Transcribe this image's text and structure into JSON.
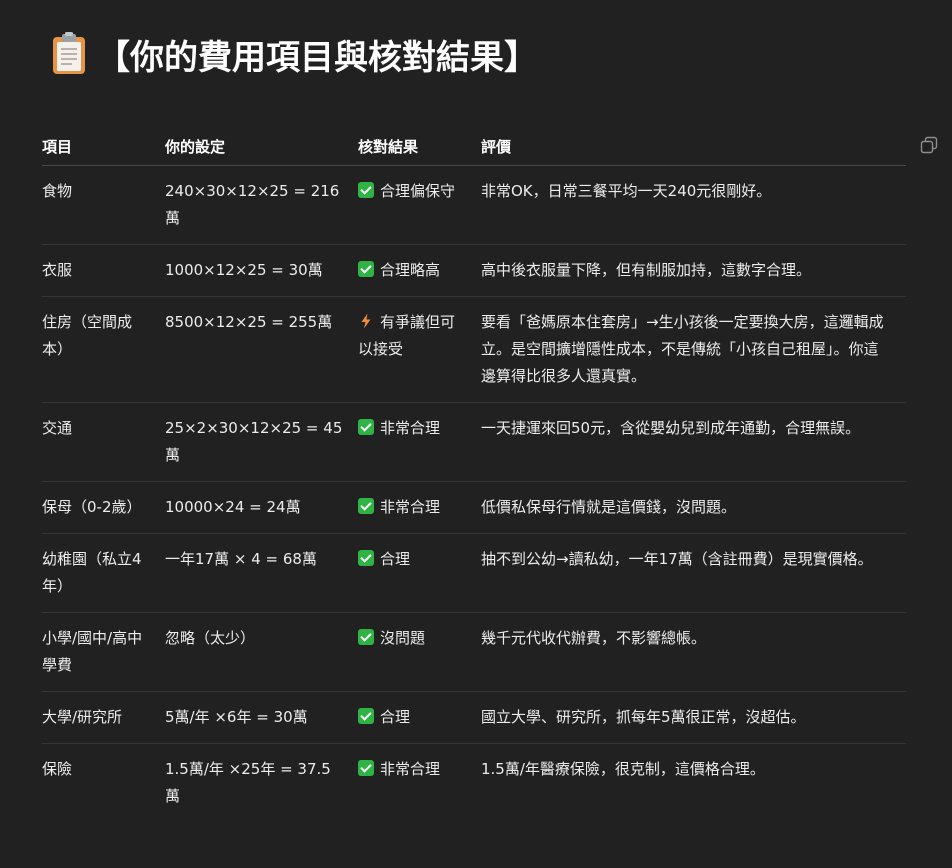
{
  "heading": {
    "icon": "clipboard-icon",
    "title": "【你的費用項目與核對結果】"
  },
  "toolbar": {
    "copy_icon": "copy-icon"
  },
  "table": {
    "headers": [
      "項目",
      "你的設定",
      "核對結果",
      "評價"
    ],
    "rows": [
      {
        "item": "食物",
        "setting": "240×30×12×25 = 216萬",
        "status_icon": "check-icon",
        "status": "合理偏保守",
        "comment": "非常OK，日常三餐平均一天240元很剛好。"
      },
      {
        "item": "衣服",
        "setting": "1000×12×25 = 30萬",
        "status_icon": "check-icon",
        "status": "合理略高",
        "comment": "高中後衣服量下降，但有制服加持，這數字合理。"
      },
      {
        "item": "住房（空間成本）",
        "setting": "8500×12×25 = 255萬",
        "status_icon": "lightning-icon",
        "status": "有爭議但可以接受",
        "comment": "要看「爸媽原本住套房」→生小孩後一定要換大房，這邏輯成立。是空間擴增隱性成本，不是傳統「小孩自己租屋」。你這邊算得比很多人還真實。"
      },
      {
        "item": "交通",
        "setting": "25×2×30×12×25 = 45萬",
        "status_icon": "check-icon",
        "status": "非常合理",
        "comment": "一天捷運來回50元，含從嬰幼兒到成年通勤，合理無誤。"
      },
      {
        "item": "保母（0-2歲）",
        "setting": "10000×24 = 24萬",
        "status_icon": "check-icon",
        "status": "非常合理",
        "comment": "低價私保母行情就是這價錢，沒問題。"
      },
      {
        "item": "幼稚園（私立4年）",
        "setting": "一年17萬 × 4 = 68萬",
        "status_icon": "check-icon",
        "status": "合理",
        "comment": "抽不到公幼→讀私幼，一年17萬（含註冊費）是現實價格。"
      },
      {
        "item": "小學/國中/高中學費",
        "setting": "忽略（太少）",
        "status_icon": "check-icon",
        "status": "沒問題",
        "comment": "幾千元代收代辦費，不影響總帳。"
      },
      {
        "item": "大學/研究所",
        "setting": "5萬/年 ×6年 = 30萬",
        "status_icon": "check-icon",
        "status": "合理",
        "comment": "國立大學、研究所，抓每年5萬很正常，沒超估。"
      },
      {
        "item": "保險",
        "setting": "1.5萬/年 ×25年 = 37.5萬",
        "status_icon": "check-icon",
        "status": "非常合理",
        "comment": "1.5萬/年醫療保險，很克制，這價格合理。"
      }
    ]
  },
  "colors": {
    "background": "#212121",
    "text": "#ececec",
    "check_green": "#2fb344",
    "bolt_orange": "#f08c3a"
  }
}
